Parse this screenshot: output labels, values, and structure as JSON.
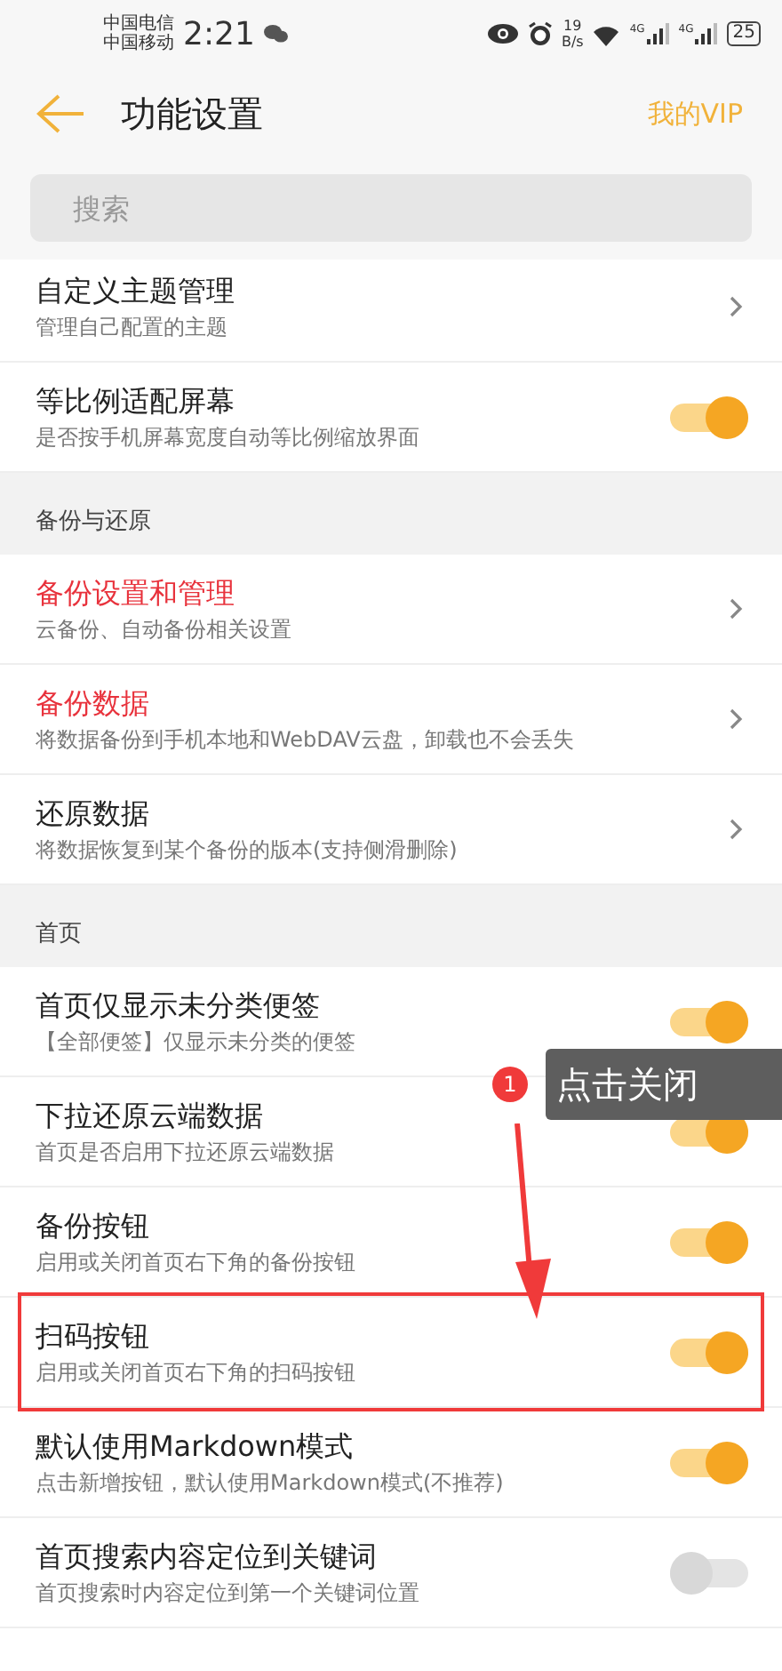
{
  "status_bar": {
    "carriers": [
      "中国电信",
      "中国移动"
    ],
    "time": "2:21",
    "net_speed": [
      "19",
      "B/s"
    ],
    "network": [
      "4G",
      "4G"
    ],
    "battery": "25"
  },
  "header": {
    "title": "功能设置",
    "action": "我的VIP"
  },
  "search": {
    "placeholder": "搜索"
  },
  "groups": [
    {
      "items": [
        {
          "kind": "chevron",
          "title": "自定义主题管理",
          "subtitle": "管理自己配置的主题",
          "emphasis": false
        },
        {
          "kind": "toggle",
          "title": "等比例适配屏幕",
          "subtitle": "是否按手机屏幕宽度自动等比例缩放界面",
          "on": true
        }
      ]
    },
    {
      "header": "备份与还原",
      "items": [
        {
          "kind": "chevron",
          "title": "备份设置和管理",
          "subtitle": "云备份、自动备份相关设置",
          "emphasis": true
        },
        {
          "kind": "chevron",
          "title": "备份数据",
          "subtitle": "将数据备份到手机本地和WebDAV云盘，卸载也不会丢失",
          "emphasis": true
        },
        {
          "kind": "chevron",
          "title": "还原数据",
          "subtitle": "将数据恢复到某个备份的版本(支持侧滑删除)",
          "emphasis": false
        }
      ]
    },
    {
      "header": "首页",
      "items": [
        {
          "kind": "toggle",
          "title": "首页仅显示未分类便签",
          "subtitle": "【全部便签】仅显示未分类的便签",
          "on": true,
          "framed": false
        },
        {
          "kind": "toggle",
          "title": "下拉还原云端数据",
          "subtitle": "首页是否启用下拉还原云端数据",
          "on": true,
          "framed": false
        },
        {
          "kind": "toggle",
          "title": "备份按钮",
          "subtitle": "启用或关闭首页右下角的备份按钮",
          "on": true,
          "framed": false
        },
        {
          "kind": "toggle",
          "title": "扫码按钮",
          "subtitle": "启用或关闭首页右下角的扫码按钮",
          "on": true,
          "framed": true
        },
        {
          "kind": "toggle",
          "title": "默认使用Markdown模式",
          "subtitle": "点击新增按钮，默认使用Markdown模式(不推荐)",
          "on": true,
          "framed": false
        },
        {
          "kind": "toggle",
          "title": "首页搜索内容定位到关键词",
          "subtitle": "首页搜索时内容定位到第一个关键词位置",
          "on": false,
          "framed": false
        }
      ]
    }
  ],
  "annotation": {
    "step": "1",
    "callout": "点击关闭"
  }
}
